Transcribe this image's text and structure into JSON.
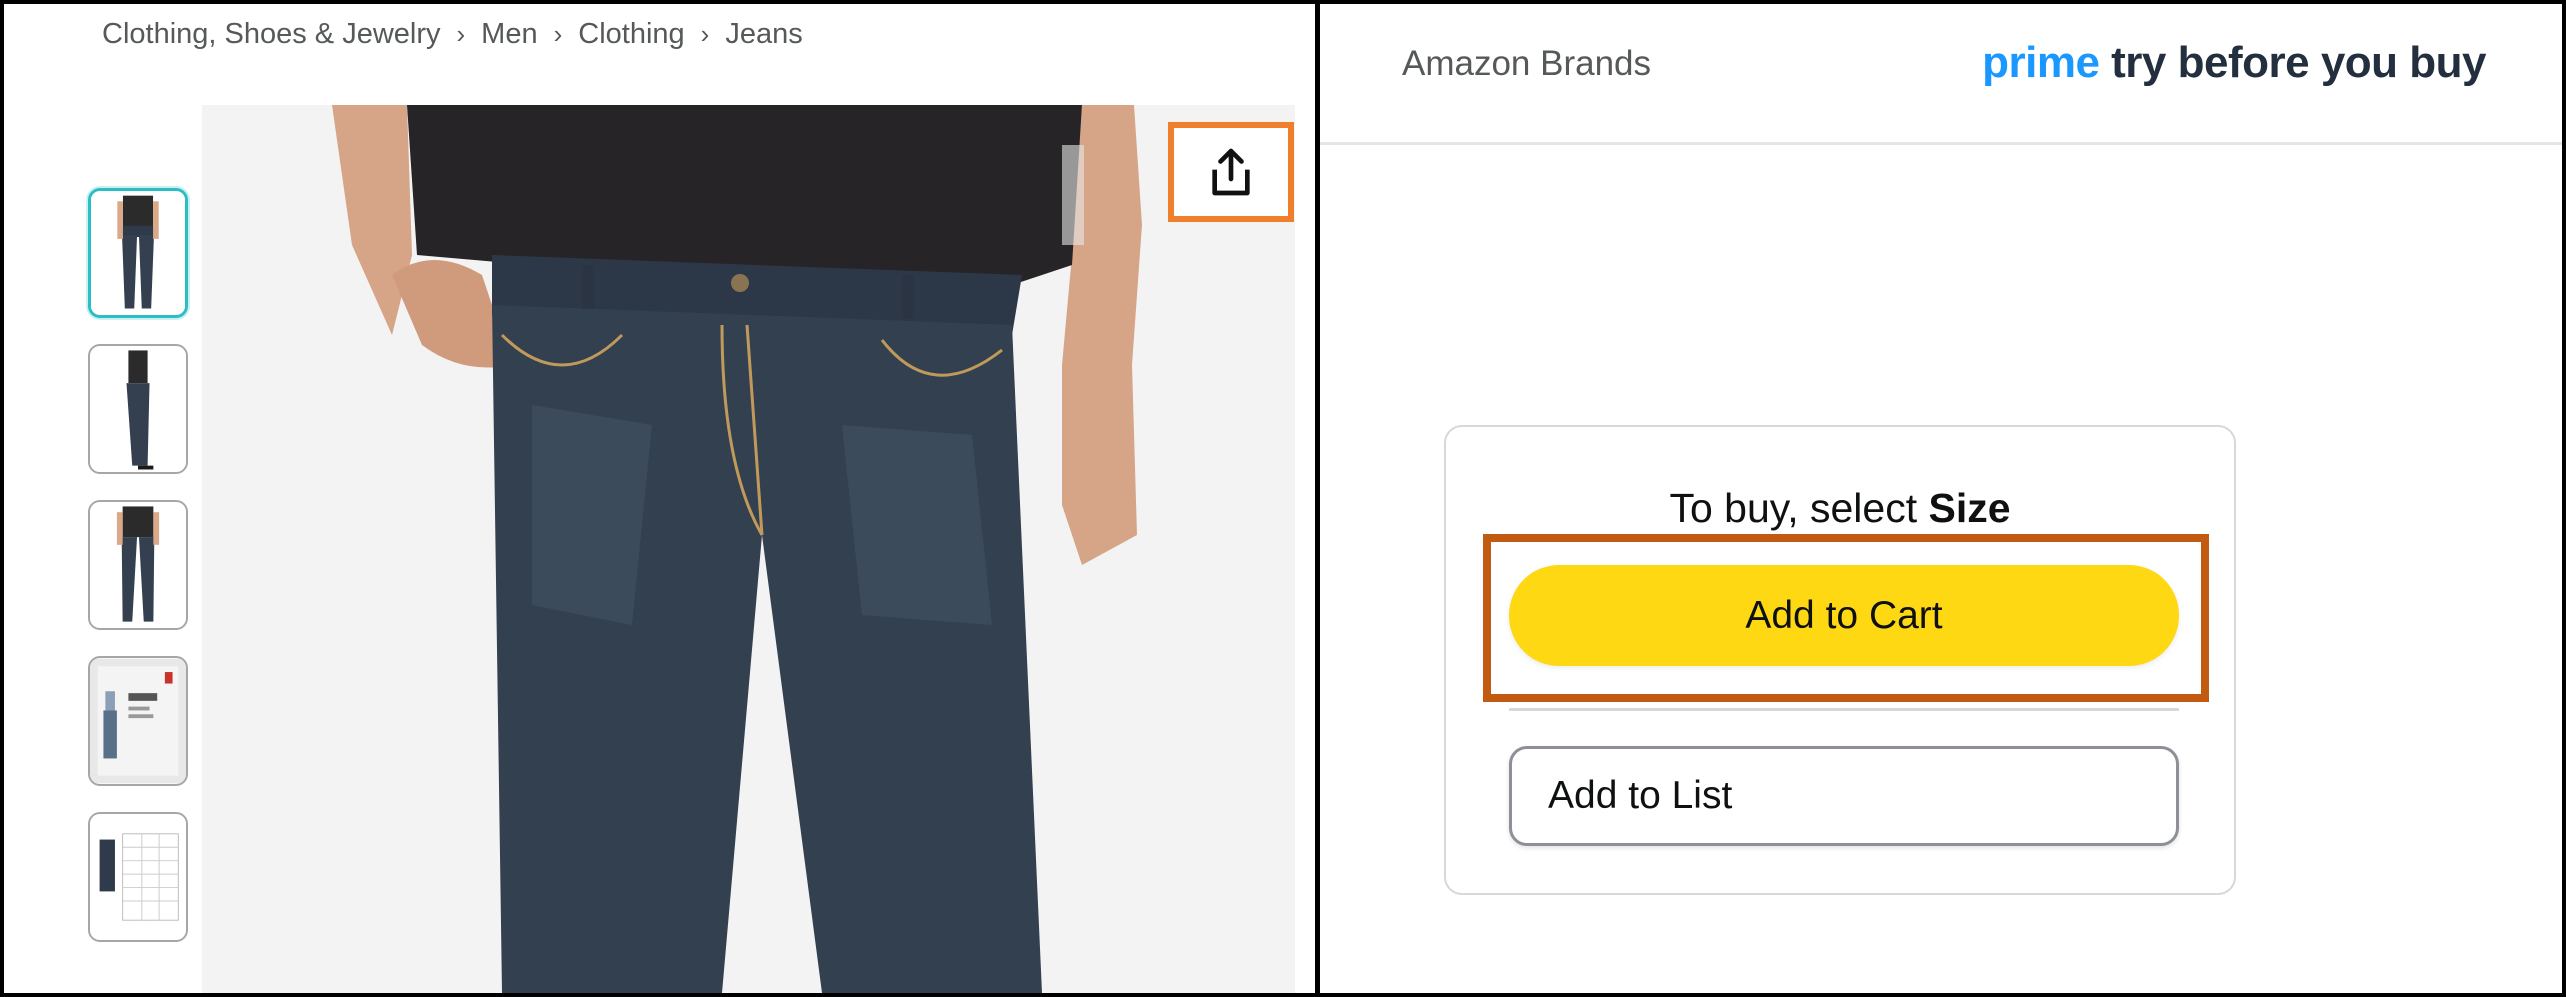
{
  "breadcrumb": {
    "items": [
      "Clothing, Shoes & Jewelry",
      "Men",
      "Clothing",
      "Jeans"
    ],
    "separator": "›"
  },
  "gallery": {
    "thumbnails": [
      {
        "name": "front view",
        "selected": true
      },
      {
        "name": "side view",
        "selected": false
      },
      {
        "name": "back view",
        "selected": false
      },
      {
        "name": "fit guide",
        "selected": false
      },
      {
        "name": "size chart",
        "selected": false
      }
    ],
    "share_icon": "share-icon",
    "share_highlight_color": "#f07f2d"
  },
  "header": {
    "brand_link": "Amazon Brands",
    "prime_word": "prime",
    "prime_tagline": "try before you buy"
  },
  "buy_box": {
    "prompt_prefix": "To buy, select ",
    "prompt_bold": "Size",
    "add_to_cart": "Add to Cart",
    "add_to_list": "Add to List",
    "cart_button_color": "#ffd814",
    "cart_highlight_color": "#c35a12"
  }
}
